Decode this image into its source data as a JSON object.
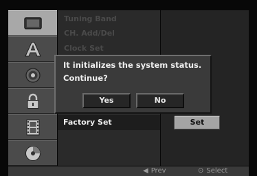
{
  "menu": {
    "items": [
      {
        "label": "Tuning Band"
      },
      {
        "label": "CH. Add/Del"
      },
      {
        "label": "Clock Set"
      },
      {
        "label": "Factory Set"
      }
    ]
  },
  "value": {
    "set_label": "Set"
  },
  "dialog": {
    "line1": "It initializes the system status.",
    "line2": "Continue?",
    "yes_label": "Yes",
    "no_label": "No"
  },
  "footer": {
    "prev_glyph": "◀",
    "prev_label": "Prev",
    "select_glyph": "⊙",
    "select_label": "Select"
  },
  "categories": [
    {
      "icon": "tv-screen-icon"
    },
    {
      "icon": "language-a-icon"
    },
    {
      "icon": "speaker-icon"
    },
    {
      "icon": "padlock-icon"
    },
    {
      "icon": "film-strip-icon"
    },
    {
      "icon": "disc-icon"
    }
  ]
}
